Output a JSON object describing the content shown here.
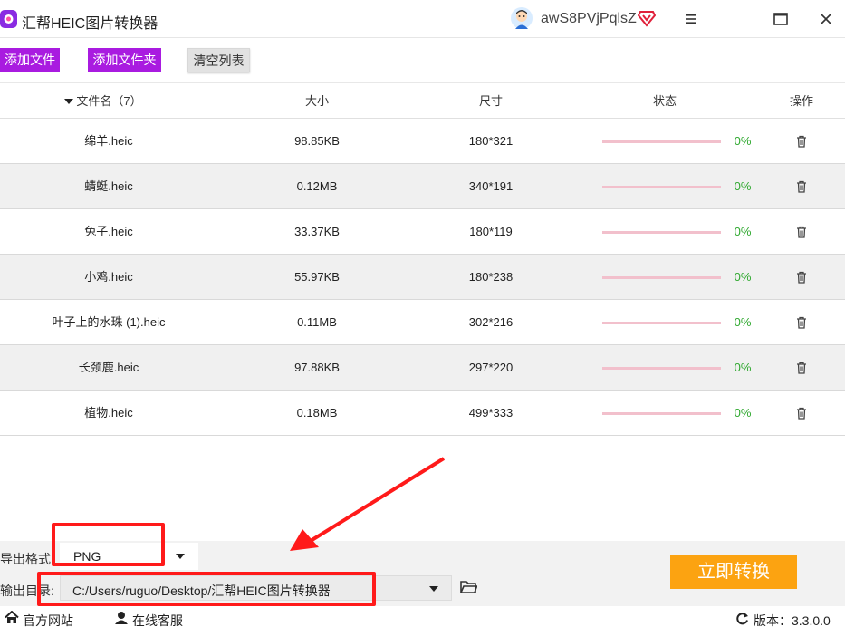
{
  "app": {
    "title": "汇帮HEIC图片转换器",
    "username": "awS8PVjPqlsZ"
  },
  "toolbar": {
    "add_file": "添加文件",
    "add_folder": "添加文件夹",
    "clear_list": "清空列表"
  },
  "table": {
    "headers": {
      "name": "文件名（7）",
      "size": "大小",
      "dimensions": "尺寸",
      "status": "状态",
      "actions": "操作"
    },
    "rows": [
      {
        "name": "绵羊.heic",
        "size": "98.85KB",
        "dimensions": "180*321",
        "progress": "0%"
      },
      {
        "name": "蜻蜓.heic",
        "size": "0.12MB",
        "dimensions": "340*191",
        "progress": "0%"
      },
      {
        "name": "兔子.heic",
        "size": "33.37KB",
        "dimensions": "180*119",
        "progress": "0%"
      },
      {
        "name": "小鸡.heic",
        "size": "55.97KB",
        "dimensions": "180*238",
        "progress": "0%"
      },
      {
        "name": "叶子上的水珠 (1).heic",
        "size": "0.11MB",
        "dimensions": "302*216",
        "progress": "0%"
      },
      {
        "name": "长颈鹿.heic",
        "size": "97.88KB",
        "dimensions": "297*220",
        "progress": "0%"
      },
      {
        "name": "植物.heic",
        "size": "0.18MB",
        "dimensions": "499*333",
        "progress": "0%"
      }
    ]
  },
  "export": {
    "format_label": "导出格式",
    "format_value": "PNG",
    "dir_label": "输出目录:",
    "dir_value": "C:/Users/ruguo/Desktop/汇帮HEIC图片转换器"
  },
  "convert_button": "立即转换",
  "statusbar": {
    "website": "官方网站",
    "support": "在线客服",
    "version": "版本：3.3.0.0"
  },
  "colors": {
    "accent_purple": "#a91be0",
    "convert_orange": "#fca311",
    "progress_track": "#f2c0cc",
    "progress_text": "#2ea82e",
    "annotation_red": "#ff1a1a"
  }
}
